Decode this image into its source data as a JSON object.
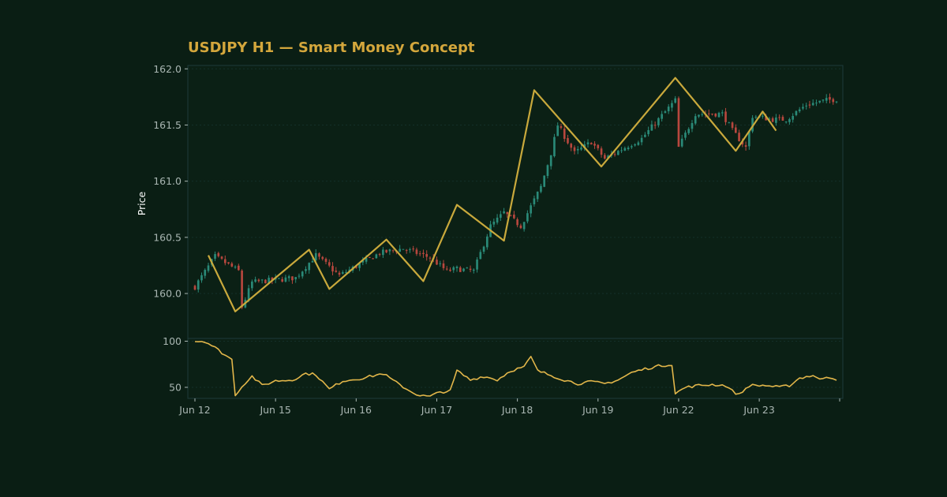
{
  "colors": {
    "background": "#0a1e14",
    "plot_background": "#0b2015",
    "axis": "#1e3a3a",
    "grid": "#14302a",
    "text": "#a9b6b2",
    "title": "#d4a73c",
    "bull": "#2a8a78",
    "bear": "#b8473e",
    "zigzag": "#c9a93c",
    "indicator": "#e2b64a"
  },
  "chart_data": [
    {
      "type": "candlestick",
      "title": "USDJPY H1 — Smart Money Concept",
      "xlabel": "",
      "ylabel": "Price",
      "ylim": [
        159.6,
        162.03
      ],
      "yticks": [
        "160.0",
        "160.5",
        "161.0",
        "161.5",
        "162.0"
      ],
      "xticks": [
        "Jun 12",
        "Jun 15",
        "Jun 16",
        "Jun 17",
        "Jun 18",
        "Jun 19",
        "Jun 22",
        "Jun 23"
      ],
      "grid": true,
      "candle_count": 192,
      "anchors": [
        [
          0,
          160.06
        ],
        [
          6,
          160.33
        ],
        [
          13,
          160.2
        ],
        [
          14,
          159.88
        ],
        [
          17,
          160.1
        ],
        [
          30,
          160.14
        ],
        [
          36,
          160.34
        ],
        [
          43,
          160.16
        ],
        [
          55,
          160.36
        ],
        [
          62,
          160.4
        ],
        [
          70,
          160.32
        ],
        [
          75,
          160.2
        ],
        [
          78,
          160.22
        ],
        [
          83,
          160.2
        ],
        [
          88,
          160.6
        ],
        [
          92,
          160.72
        ],
        [
          97,
          160.6
        ],
        [
          103,
          160.95
        ],
        [
          106,
          161.25
        ],
        [
          108,
          161.5
        ],
        [
          110,
          161.4
        ],
        [
          113,
          161.25
        ],
        [
          118,
          161.35
        ],
        [
          122,
          161.2
        ],
        [
          128,
          161.3
        ],
        [
          133,
          161.38
        ],
        [
          138,
          161.55
        ],
        [
          143,
          161.72
        ],
        [
          144,
          161.3
        ],
        [
          149,
          161.6
        ],
        [
          157,
          161.6
        ],
        [
          160,
          161.45
        ],
        [
          164,
          161.3
        ],
        [
          166,
          161.58
        ],
        [
          172,
          161.55
        ],
        [
          176,
          161.55
        ],
        [
          182,
          161.68
        ],
        [
          188,
          161.72
        ],
        [
          191,
          161.73
        ]
      ],
      "zigzag": [
        [
          4,
          160.34
        ],
        [
          12,
          159.84
        ],
        [
          34,
          160.39
        ],
        [
          40,
          160.04
        ],
        [
          57,
          160.48
        ],
        [
          68,
          160.11
        ],
        [
          78,
          160.79
        ],
        [
          92,
          160.47
        ],
        [
          101,
          161.81
        ],
        [
          121,
          161.13
        ],
        [
          143,
          161.92
        ],
        [
          161,
          161.27
        ],
        [
          169,
          161.62
        ],
        [
          173,
          161.45
        ]
      ]
    },
    {
      "type": "line",
      "title": "",
      "xlabel": "",
      "ylabel": "",
      "ylim": [
        38,
        103
      ],
      "yticks": [
        "50",
        "100"
      ],
      "grid": true,
      "anchors": [
        [
          0,
          100
        ],
        [
          3,
          100
        ],
        [
          6,
          93
        ],
        [
          9,
          85
        ],
        [
          11,
          80
        ],
        [
          12,
          42
        ],
        [
          15,
          55
        ],
        [
          17,
          62
        ],
        [
          20,
          52
        ],
        [
          24,
          57
        ],
        [
          29,
          58
        ],
        [
          33,
          65
        ],
        [
          36,
          64
        ],
        [
          40,
          48
        ],
        [
          44,
          57
        ],
        [
          50,
          60
        ],
        [
          56,
          65
        ],
        [
          60,
          55
        ],
        [
          64,
          46
        ],
        [
          67,
          41
        ],
        [
          70,
          40
        ],
        [
          73,
          45
        ],
        [
          76,
          46
        ],
        [
          78,
          68
        ],
        [
          82,
          58
        ],
        [
          86,
          62
        ],
        [
          90,
          58
        ],
        [
          94,
          68
        ],
        [
          98,
          72
        ],
        [
          100,
          83
        ],
        [
          102,
          68
        ],
        [
          106,
          63
        ],
        [
          110,
          58
        ],
        [
          114,
          54
        ],
        [
          118,
          56
        ],
        [
          122,
          54
        ],
        [
          126,
          58
        ],
        [
          130,
          66
        ],
        [
          134,
          70
        ],
        [
          138,
          73
        ],
        [
          142,
          75
        ],
        [
          143,
          43
        ],
        [
          146,
          50
        ],
        [
          150,
          52
        ],
        [
          154,
          53
        ],
        [
          158,
          52
        ],
        [
          160,
          46
        ],
        [
          162,
          42
        ],
        [
          165,
          52
        ],
        [
          170,
          52
        ],
        [
          174,
          50
        ],
        [
          177,
          52
        ],
        [
          180,
          60
        ],
        [
          184,
          63
        ],
        [
          186,
          58
        ],
        [
          188,
          62
        ],
        [
          191,
          59
        ]
      ]
    }
  ]
}
